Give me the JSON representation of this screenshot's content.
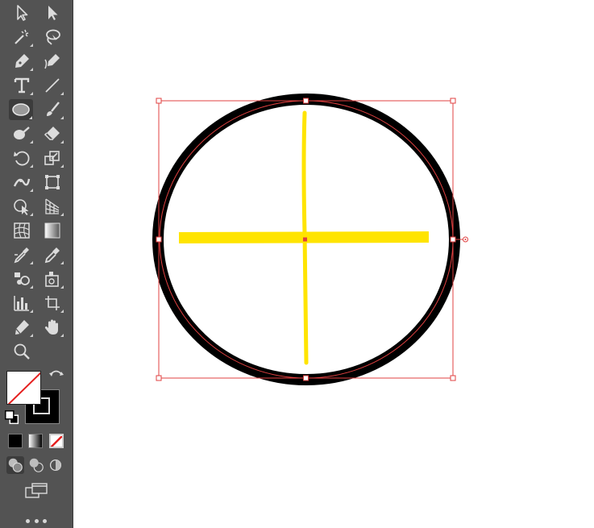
{
  "toolbar": {
    "tools": [
      {
        "id": "selection",
        "icon": "selection-arrow-icon"
      },
      {
        "id": "direct-selection",
        "icon": "direct-selection-arrow-icon"
      },
      {
        "id": "magic-wand",
        "icon": "magic-wand-icon"
      },
      {
        "id": "lasso",
        "icon": "lasso-icon"
      },
      {
        "id": "pen",
        "icon": "pen-icon"
      },
      {
        "id": "curvature",
        "icon": "curvature-pen-icon"
      },
      {
        "id": "type",
        "icon": "type-icon",
        "glyph": "T"
      },
      {
        "id": "line-segment",
        "icon": "line-segment-icon"
      },
      {
        "id": "ellipse",
        "icon": "ellipse-icon",
        "active": true
      },
      {
        "id": "paintbrush",
        "icon": "paintbrush-icon"
      },
      {
        "id": "shaper",
        "icon": "shaper-icon"
      },
      {
        "id": "eraser",
        "icon": "eraser-icon"
      },
      {
        "id": "rotate",
        "icon": "rotate-icon"
      },
      {
        "id": "scale",
        "icon": "scale-icon"
      },
      {
        "id": "width",
        "icon": "width-tool-icon"
      },
      {
        "id": "free-transform",
        "icon": "free-transform-icon"
      },
      {
        "id": "shape-builder",
        "icon": "shape-builder-icon"
      },
      {
        "id": "perspective-grid",
        "icon": "perspective-grid-icon"
      },
      {
        "id": "mesh",
        "icon": "mesh-icon"
      },
      {
        "id": "gradient",
        "icon": "gradient-icon"
      },
      {
        "id": "blend",
        "icon": "blend-icon"
      },
      {
        "id": "eyedropper",
        "icon": "eyedropper-icon"
      },
      {
        "id": "symbol-sprayer",
        "icon": "symbol-sprayer-icon"
      },
      {
        "id": "slice-select",
        "icon": "slice-select-icon"
      },
      {
        "id": "column-graph",
        "icon": "column-graph-icon"
      },
      {
        "id": "artboard",
        "icon": "artboard-icon"
      },
      {
        "id": "pencil",
        "icon": "pencil-icon"
      },
      {
        "id": "hand",
        "icon": "hand-icon"
      },
      {
        "id": "zoom",
        "icon": "zoom-icon"
      }
    ],
    "swap_icon": "swap-fill-stroke-icon",
    "default_colors_icon": "default-fill-stroke-icon",
    "fill_color": "none",
    "stroke_color": "#000000",
    "color_modes": [
      "color",
      "gradient",
      "none"
    ],
    "draw_modes": [
      "draw-normal",
      "draw-behind",
      "draw-inside"
    ],
    "screen_mode_icon": "change-screen-mode-icon",
    "more_icon": "edit-toolbar-more-icon"
  },
  "canvas": {
    "shape": "ellipse",
    "fill": "#ffffff",
    "stroke": "#000000",
    "selection_color": "#e04040",
    "annotation_color": "#ffe400"
  }
}
